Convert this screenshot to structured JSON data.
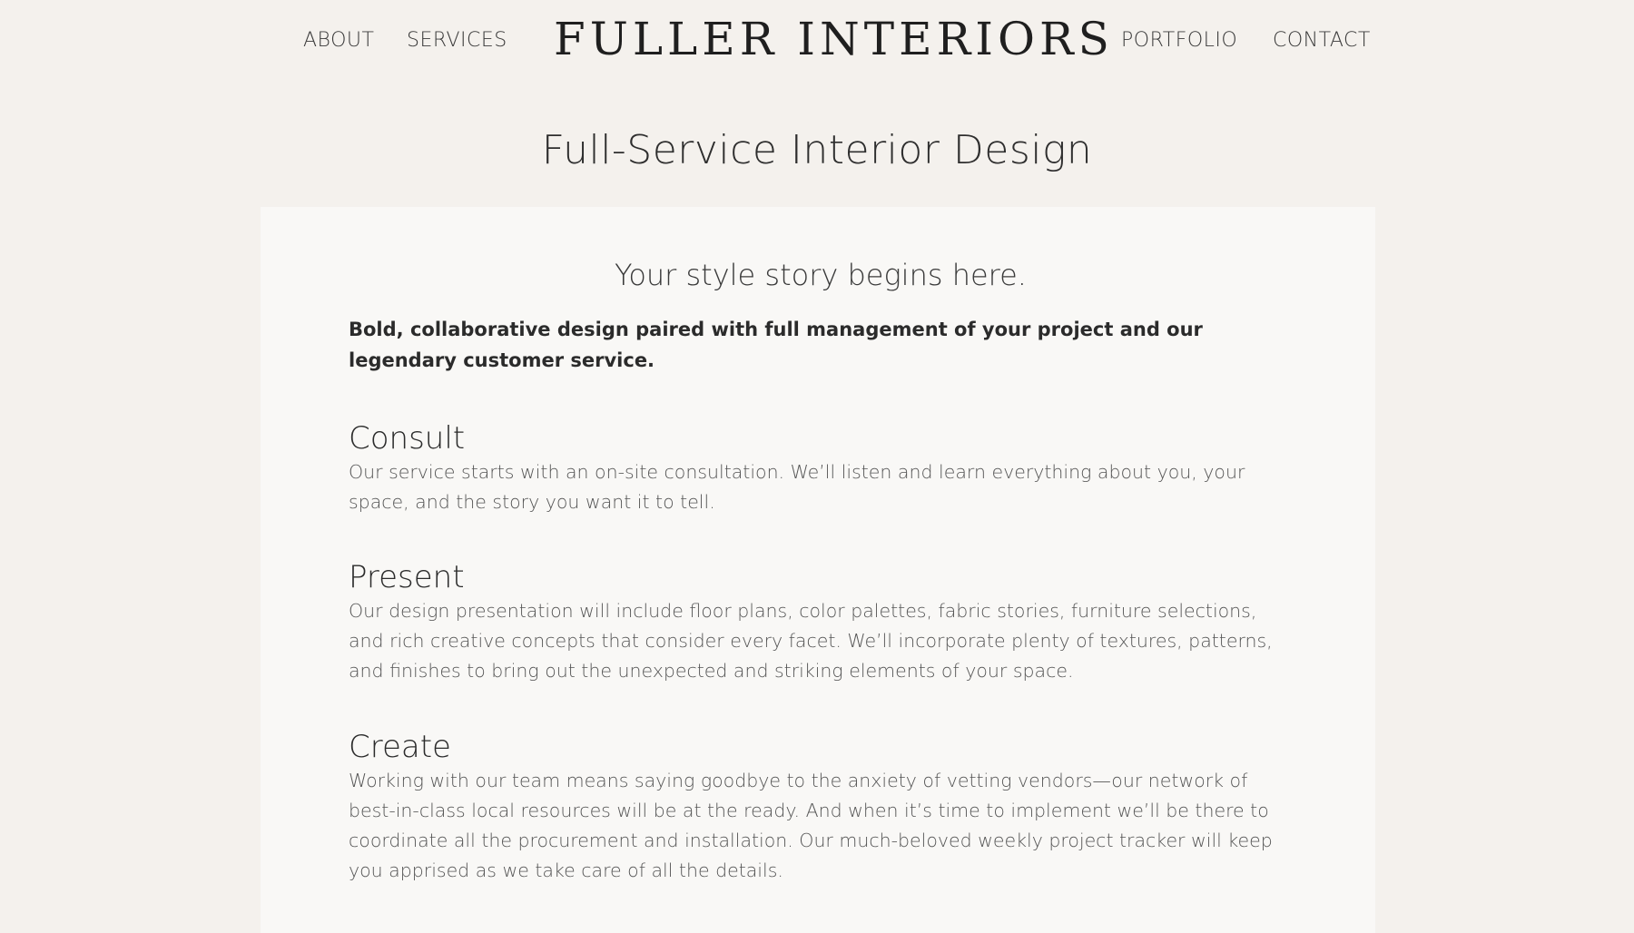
{
  "nav": {
    "about": "ABOUT",
    "services": "SERVICES",
    "logo": "FULLER INTERIORS",
    "portfolio": "PORTFOLIO",
    "contact": "CONTACT"
  },
  "page": {
    "title": "Full-Service Interior Design"
  },
  "card": {
    "tagline": "Your style story begins here.",
    "intro": "Bold, collaborative design paired with full management of your project and our legendary customer service.",
    "sections": [
      {
        "heading": "Consult",
        "body": "Our service starts with an on-site consultation. We’ll listen and learn everything about you, your space, and the story you want it to tell."
      },
      {
        "heading": "Present",
        "body": "Our design presentation will include floor plans, color palettes, fabric stories, furniture selections, and rich creative concepts that consider every facet. We’ll incorporate plenty of textures, patterns, and finishes to bring out the unexpected and striking elements of your space."
      },
      {
        "heading": "Create",
        "body": "Working with our team means saying goodbye to the anxiety of vetting vendors—our network of best-in-class local resources will be at the ready. And when it’s time to implement we’ll be there to coordinate all the procurement and installation. Our much-beloved weekly project tracker will keep you apprised as we take care of all the details."
      }
    ]
  },
  "colors": {
    "page_background": "#f4f1ed",
    "card_background": "#f9f8f6",
    "text": "#2b2b2b",
    "body_text": "#555555"
  }
}
